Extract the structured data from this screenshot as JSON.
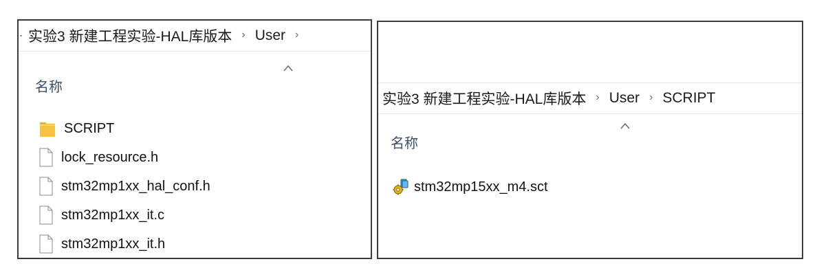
{
  "left_window": {
    "breadcrumb": [
      "实验3 新建工程实验-HAL库版本",
      "User"
    ],
    "separator": "›",
    "column_header": "名称",
    "files": [
      {
        "name": "SCRIPT",
        "icon": "folder-icon"
      },
      {
        "name": "lock_resource.h",
        "icon": "file-icon"
      },
      {
        "name": "stm32mp1xx_hal_conf.h",
        "icon": "file-icon"
      },
      {
        "name": "stm32mp1xx_it.c",
        "icon": "file-icon"
      },
      {
        "name": "stm32mp1xx_it.h",
        "icon": "file-icon"
      }
    ]
  },
  "right_window": {
    "breadcrumb": [
      "实验3 新建工程实验-HAL库版本",
      "User",
      "SCRIPT"
    ],
    "separator": "›",
    "column_header": "名称",
    "files": [
      {
        "name": "stm32mp15xx_m4.sct",
        "icon": "scatter-file-icon"
      }
    ]
  },
  "colors": {
    "folder": "#f5c242",
    "header_text": "#3b4f6e",
    "border": "#3c3c3c"
  }
}
